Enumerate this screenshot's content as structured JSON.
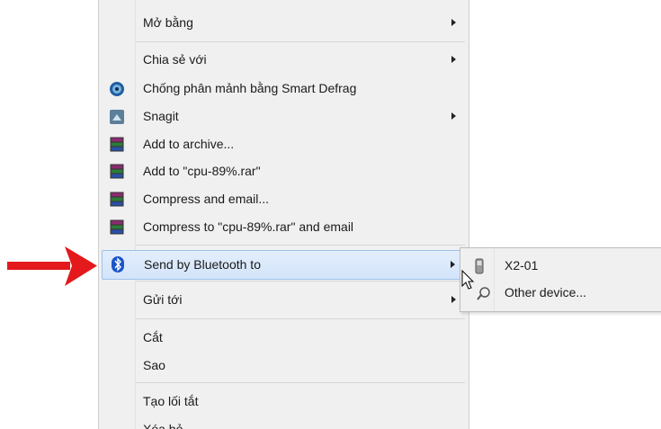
{
  "menu": {
    "items": [
      {
        "label": "Mở bằng"
      },
      {
        "label": "Chia sẻ với"
      },
      {
        "label": "Chống phân mảnh bằng Smart Defrag"
      },
      {
        "label": "Snagit"
      },
      {
        "label": "Add to archive..."
      },
      {
        "label": "Add to \"cpu-89%.rar\""
      },
      {
        "label": "Compress and email..."
      },
      {
        "label": "Compress to \"cpu-89%.rar\" and email"
      },
      {
        "label": "Send by Bluetooth to"
      },
      {
        "label": "Gửi tới"
      },
      {
        "label": "Cắt"
      },
      {
        "label": "Sao"
      },
      {
        "label": "Tạo lối tắt"
      },
      {
        "label": "Xóa bỏ"
      }
    ]
  },
  "submenu": {
    "items": [
      {
        "label": "X2-01"
      },
      {
        "label": "Other device..."
      }
    ]
  },
  "icons": {
    "defrag": "smart-defrag-icon",
    "snagit": "snagit-icon",
    "archive": "winrar-icon",
    "bluetooth": "bluetooth-icon",
    "phone": "phone-icon",
    "device": "device-search-icon",
    "pointer": "red-arrow-icon"
  },
  "colors": {
    "highlight": "#d3e4fa",
    "bluetooth": "#1c55c8",
    "red_arrow": "#e3191b"
  }
}
